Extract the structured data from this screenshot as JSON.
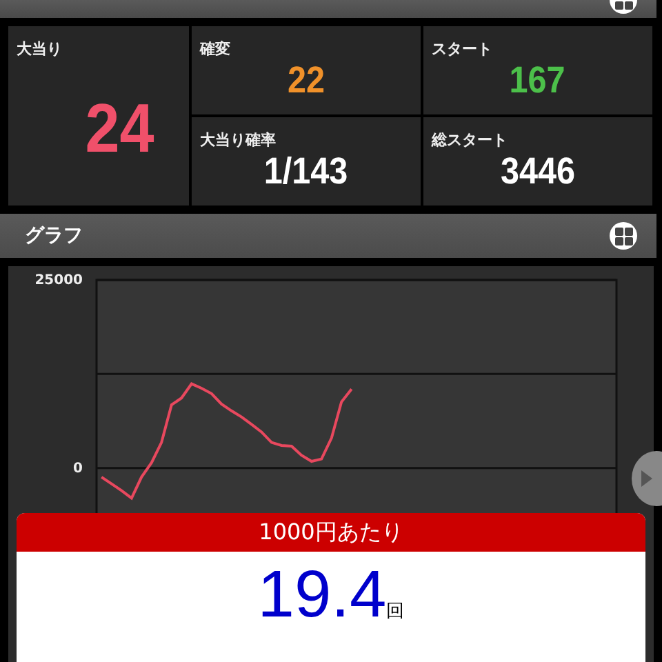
{
  "stats": [
    {
      "label": "大当り",
      "value": "24",
      "color": "#f0506a",
      "kind": "big"
    },
    {
      "label": "確変",
      "value": "22",
      "color": "#f0912a",
      "kind": "small"
    },
    {
      "label": "スタート",
      "value": "167",
      "color": "#4cc04a",
      "kind": "small"
    },
    {
      "label": "大当り確率",
      "value": "1/143",
      "color": "#ffffff",
      "kind": "small"
    },
    {
      "label": "総スタート",
      "value": "3446",
      "color": "#ffffff",
      "kind": "small"
    }
  ],
  "graph": {
    "title": "グラフ",
    "chart_data": {
      "type": "line",
      "categories": [
        null,
        null,
        null,
        null,
        null,
        null,
        null,
        null,
        null,
        null,
        null,
        null,
        null,
        null,
        null,
        null,
        null,
        null,
        null,
        null,
        null,
        null,
        null,
        null,
        null,
        null,
        null,
        null,
        null,
        null,
        null,
        null,
        null,
        null,
        null,
        null,
        null,
        null,
        null,
        null,
        null,
        null,
        null,
        null,
        null,
        null,
        null,
        null,
        null,
        null,
        null,
        null
      ],
      "ylim": [
        -8000,
        25000
      ],
      "yticks": [
        0,
        25000
      ],
      "series": [
        {
          "color": "#e8485e",
          "values": [
            -1200,
            -2100,
            -3000,
            -4000,
            -1200,
            700,
            3400,
            8400,
            9300,
            11200,
            10600,
            9900,
            8500,
            7600,
            6800,
            5800,
            4800,
            3400,
            3000,
            2900,
            1700,
            900,
            1200,
            4000,
            8800,
            10500,
            null,
            null,
            null,
            null,
            null,
            null,
            null,
            null,
            null,
            null,
            null,
            null,
            null,
            null,
            null,
            null,
            null,
            null,
            null,
            null,
            null,
            null,
            null,
            null,
            null,
            null
          ]
        }
      ]
    }
  },
  "per_1000": {
    "title": "1000円あたり",
    "value": "19.4",
    "unit": "回"
  }
}
